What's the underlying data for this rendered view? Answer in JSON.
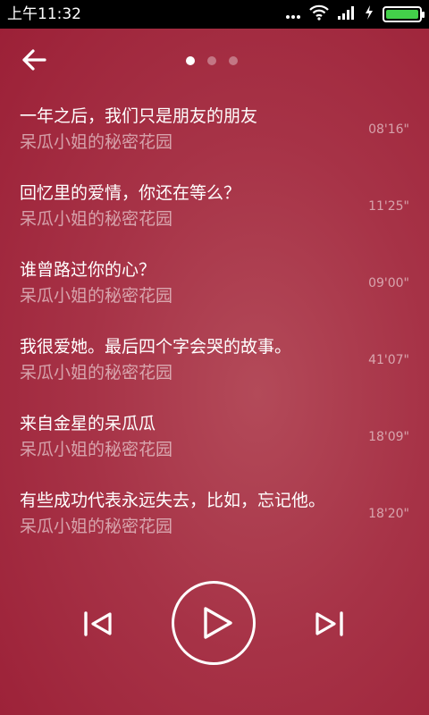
{
  "status_bar": {
    "time": "上午11:32",
    "icons": [
      "notification-dots-icon",
      "wifi-icon",
      "signal-icon",
      "charging-icon",
      "battery-icon"
    ],
    "battery_color": "#43d14a"
  },
  "header": {
    "back_icon": "arrow-left-icon",
    "pager": {
      "count": 3,
      "active_index": 0
    }
  },
  "episodes": [
    {
      "title": "一年之后，我们只是朋友的朋友",
      "author": "呆瓜小姐的秘密花园",
      "duration": "08'16\""
    },
    {
      "title": "回忆里的爱情，你还在等么？",
      "author": "呆瓜小姐的秘密花园",
      "duration": "11'25\""
    },
    {
      "title": "谁曾路过你的心？",
      "author": "呆瓜小姐的秘密花园",
      "duration": "09'00\""
    },
    {
      "title": "我很爱她。最后四个字会哭的故事。",
      "author": "呆瓜小姐的秘密花园",
      "duration": "41'07\""
    },
    {
      "title": "来自金星的呆瓜瓜",
      "author": "呆瓜小姐的秘密花园",
      "duration": "18'09\""
    },
    {
      "title": "有些成功代表永远失去，比如，忘记他。",
      "author": "呆瓜小姐的秘密花园",
      "duration": "18'20\""
    }
  ],
  "player": {
    "prev_icon": "skip-previous-icon",
    "play_icon": "play-icon",
    "next_icon": "skip-next-icon"
  },
  "theme": {
    "background": "#a52a40"
  }
}
